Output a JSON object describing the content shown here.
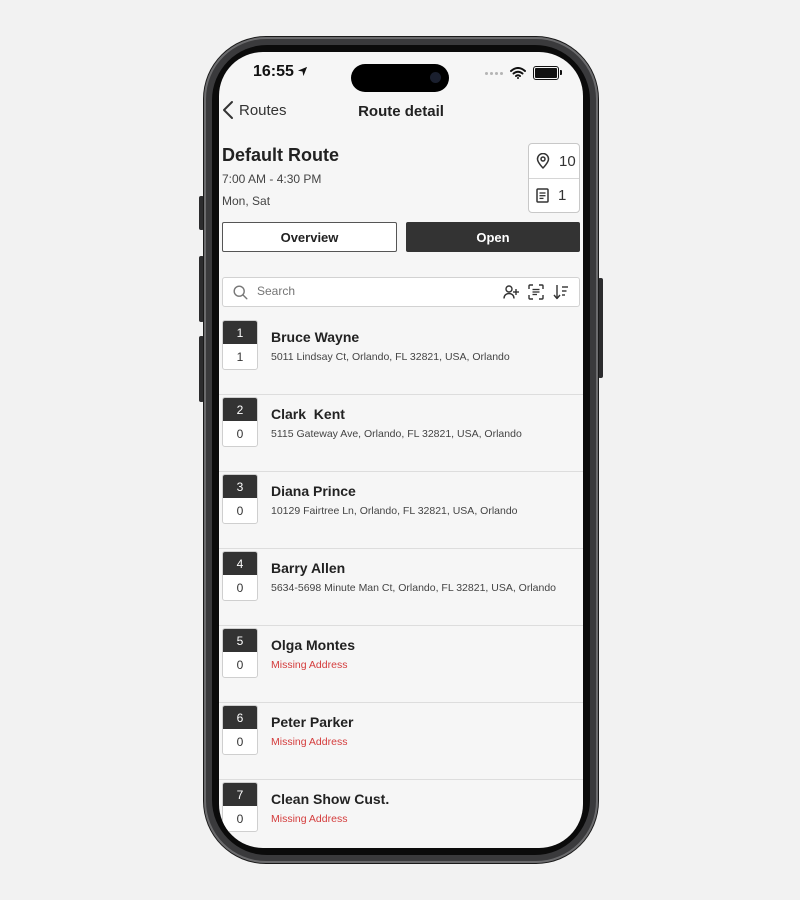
{
  "status_bar": {
    "time": "16:55"
  },
  "nav": {
    "back_label": "Routes",
    "title": "Route detail"
  },
  "route": {
    "name": "Default Route",
    "hours": "7:00 AM - 4:30 PM",
    "days": "Mon, Sat",
    "stops_count": "10",
    "docs_count": "1"
  },
  "tabs": {
    "overview": "Overview",
    "open": "Open"
  },
  "search": {
    "placeholder": "Search"
  },
  "stops": [
    {
      "num": "1",
      "count": "1",
      "name": "Bruce Wayne",
      "address": "5011 Lindsay Ct, Orlando, FL 32821, USA, Orlando",
      "missing": false
    },
    {
      "num": "2",
      "count": "0",
      "name": "Clark  Kent",
      "address": "5115 Gateway Ave, Orlando, FL 32821, USA, Orlando",
      "missing": false
    },
    {
      "num": "3",
      "count": "0",
      "name": "Diana Prince",
      "address": "10129 Fairtree Ln, Orlando, FL 32821, USA, Orlando",
      "missing": false
    },
    {
      "num": "4",
      "count": "0",
      "name": "Barry Allen",
      "address": "5634-5698 Minute Man Ct, Orlando, FL 32821, USA, Orlando",
      "missing": false
    },
    {
      "num": "5",
      "count": "0",
      "name": "Olga Montes",
      "address": "Missing Address",
      "missing": true
    },
    {
      "num": "6",
      "count": "0",
      "name": "Peter Parker",
      "address": "Missing Address",
      "missing": true
    },
    {
      "num": "7",
      "count": "0",
      "name": "Clean Show Cust.",
      "address": "Missing Address",
      "missing": true
    }
  ],
  "colors": {
    "dark": "#333333",
    "missing": "#d43c3c",
    "background": "#f6f6f6"
  }
}
